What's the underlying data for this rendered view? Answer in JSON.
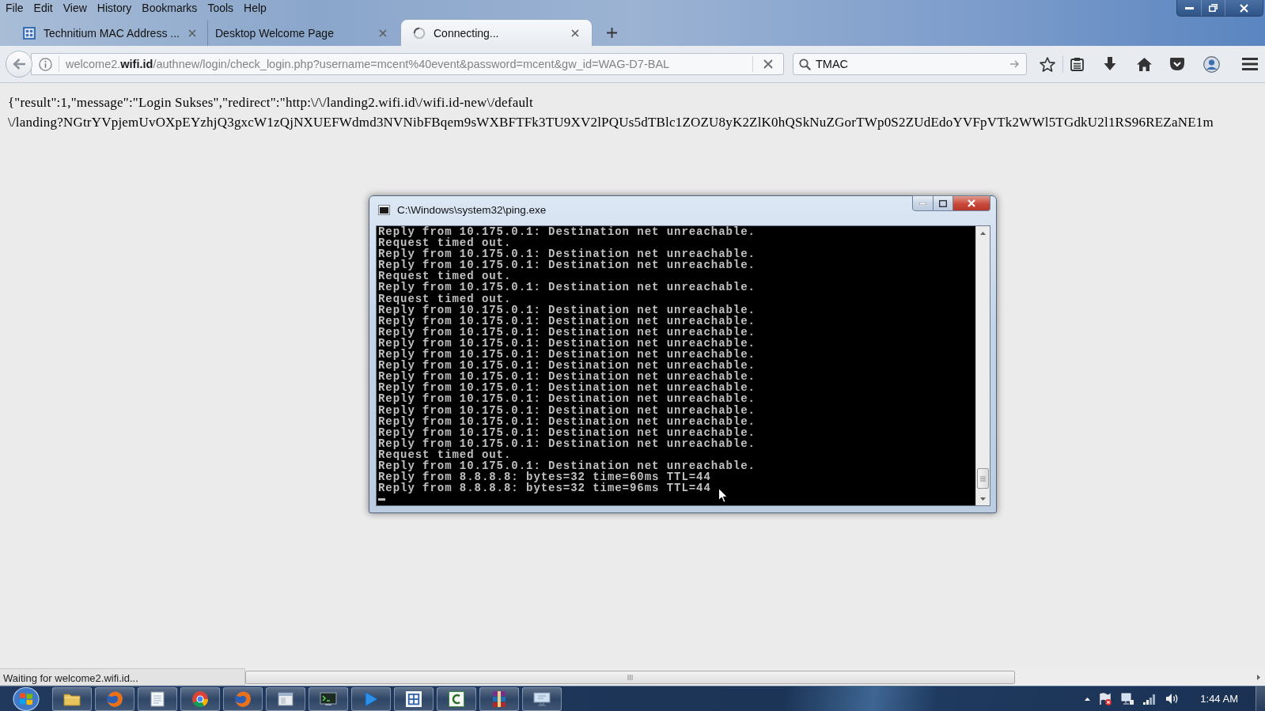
{
  "browser": {
    "menu": [
      "File",
      "Edit",
      "View",
      "History",
      "Bookmarks",
      "Tools",
      "Help"
    ],
    "tabs": [
      {
        "title": "Technitium MAC Address ...",
        "kind": "favicon",
        "selected": false
      },
      {
        "title": "Desktop Welcome Page",
        "kind": "plain",
        "selected": false
      },
      {
        "title": "Connecting...",
        "kind": "loading",
        "selected": true
      }
    ],
    "address": "welcome2.**wifi.id**/authnew/login/check_login.php?username=mcent%40event&password=mcent&gw_id=WAG-D7-BAL",
    "search": {
      "value": "TMAC"
    }
  },
  "page": {
    "response_lines": [
      "{\"result\":1,\"message\":\"Login Sukses\",\"redirect\":\"http:\\/\\/landing2.wifi.id\\/wifi.id-new\\/default",
      "\\/landing?NGtrYVpjemUvOXpEYzhjQ3gxcW1zQjNXUEFWdmd3NVNibFBqem9sWXBFTFk3TU9XV2lPQUs5dTBlc1ZOZU8yK2ZlK0hQSkNuZGorTWp0S2ZUdEdoYVFpVTk2WWl5TGdkU2l1RS96REZaNE1m"
    ]
  },
  "console": {
    "title": "C:\\Windows\\system32\\ping.exe",
    "lines": [
      "Reply from 10.175.0.1: Destination net unreachable.",
      "Request timed out.",
      "Reply from 10.175.0.1: Destination net unreachable.",
      "Reply from 10.175.0.1: Destination net unreachable.",
      "Request timed out.",
      "Reply from 10.175.0.1: Destination net unreachable.",
      "Request timed out.",
      "Reply from 10.175.0.1: Destination net unreachable.",
      "Reply from 10.175.0.1: Destination net unreachable.",
      "Reply from 10.175.0.1: Destination net unreachable.",
      "Reply from 10.175.0.1: Destination net unreachable.",
      "Reply from 10.175.0.1: Destination net unreachable.",
      "Reply from 10.175.0.1: Destination net unreachable.",
      "Reply from 10.175.0.1: Destination net unreachable.",
      "Reply from 10.175.0.1: Destination net unreachable.",
      "Reply from 10.175.0.1: Destination net unreachable.",
      "Reply from 10.175.0.1: Destination net unreachable.",
      "Reply from 10.175.0.1: Destination net unreachable.",
      "Reply from 10.175.0.1: Destination net unreachable.",
      "Reply from 10.175.0.1: Destination net unreachable.",
      "Request timed out.",
      "Reply from 10.175.0.1: Destination net unreachable.",
      "Reply from 8.8.8.8: bytes=32 time=60ms TTL=44",
      "Reply from 8.8.8.8: bytes=32 time=96ms TTL=44"
    ]
  },
  "status_bar": {
    "text": "Waiting for welcome2.wifi.id..."
  },
  "taskbar": {
    "clock": "1:44 AM"
  }
}
